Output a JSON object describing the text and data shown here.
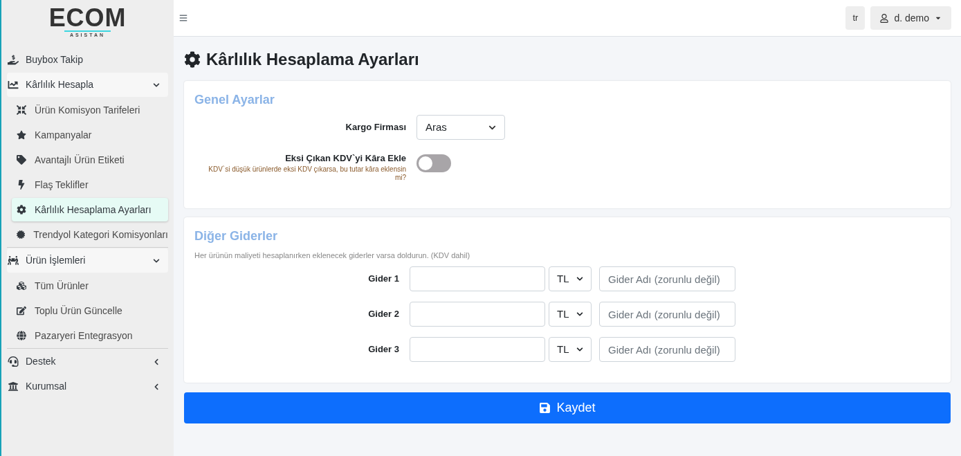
{
  "logo": {
    "text": "ECOM",
    "subtext": "ASISTAN"
  },
  "sidebar": {
    "items": [
      {
        "kind": "link",
        "label": "Buybox Takip"
      },
      {
        "kind": "group",
        "label": "Kârlılık Hesapla",
        "expanded": true,
        "children": [
          {
            "label": "Ürün Komisyon Tarifeleri",
            "selected": false
          },
          {
            "label": "Kampanyalar",
            "selected": false
          },
          {
            "label": "Avantajlı Ürün Etiketi",
            "selected": false
          },
          {
            "label": "Flaş Teklifler",
            "selected": false
          },
          {
            "label": "Kârlılık Hesaplama Ayarları",
            "selected": true
          },
          {
            "label": "Trendyol Kategori Komisyonları",
            "selected": false
          }
        ]
      },
      {
        "kind": "group",
        "label": "Ürün İşlemleri",
        "expanded": true,
        "children": [
          {
            "label": "Tüm Ürünler",
            "selected": false
          },
          {
            "label": "Toplu Ürün Güncelle",
            "selected": false
          },
          {
            "label": "Pazaryeri Entegrasyon",
            "selected": false
          }
        ]
      },
      {
        "kind": "group",
        "label": "Destek",
        "expanded": false
      },
      {
        "kind": "group",
        "label": "Kurumsal",
        "expanded": false
      }
    ]
  },
  "topbar": {
    "language": "tr",
    "user": "d. demo"
  },
  "page_title": "Kârlılık Hesaplama Ayarları",
  "general": {
    "title": "Genel Ayarlar",
    "cargo_label": "Kargo Firması",
    "cargo_value": "Aras",
    "vat_label": "Eksi Çıkan KDV`yi Kâra Ekle",
    "vat_hint": "KDV`si düşük ürünlerde eksi KDV çıkarsa, bu tutar kâra eklensin mi?",
    "vat_on": false
  },
  "expenses": {
    "title": "Diğer Giderler",
    "hint": "Her ürünün maliyeti hesaplanırken eklenecek giderler varsa doldurun. (KDV dahil)",
    "rows": [
      {
        "label": "Gider 1",
        "currency": "TL",
        "name_placeholder": "Gider Adı (zorunlu değil)"
      },
      {
        "label": "Gider 2",
        "currency": "TL",
        "name_placeholder": "Gider Adı (zorunlu değil)"
      },
      {
        "label": "Gider 3",
        "currency": "TL",
        "name_placeholder": "Gider Adı (zorunlu değil)"
      }
    ]
  },
  "save_button": "Kaydet"
}
